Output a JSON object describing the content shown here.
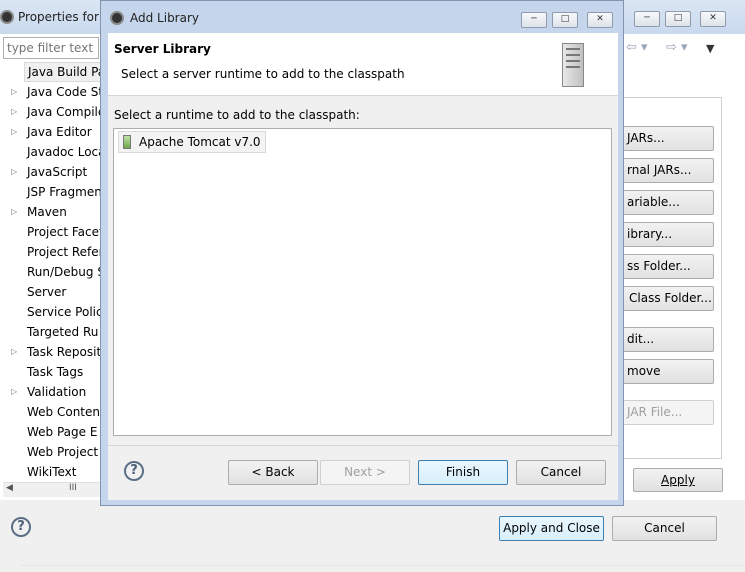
{
  "parent": {
    "title": "Properties for",
    "filter_placeholder": "type filter text",
    "tree": [
      {
        "label": "Java Build Pa",
        "arrow": false,
        "selected": true
      },
      {
        "label": "Java Code St",
        "arrow": true
      },
      {
        "label": "Java Compile",
        "arrow": true
      },
      {
        "label": "Java Editor",
        "arrow": true
      },
      {
        "label": "Javadoc Loca",
        "arrow": false
      },
      {
        "label": "JavaScript",
        "arrow": true
      },
      {
        "label": "JSP Fragmen",
        "arrow": false
      },
      {
        "label": "Maven",
        "arrow": true
      },
      {
        "label": "Project Facet",
        "arrow": false
      },
      {
        "label": "Project Refer",
        "arrow": false
      },
      {
        "label": "Run/Debug S",
        "arrow": false
      },
      {
        "label": "Server",
        "arrow": false
      },
      {
        "label": "Service Polic",
        "arrow": false
      },
      {
        "label": "Targeted Ru",
        "arrow": false
      },
      {
        "label": "Task Reposit",
        "arrow": true
      },
      {
        "label": "Task Tags",
        "arrow": false
      },
      {
        "label": "Validation",
        "arrow": true
      },
      {
        "label": "Web Conten",
        "arrow": false
      },
      {
        "label": "Web Page E",
        "arrow": false
      },
      {
        "label": "Web Project",
        "arrow": false
      },
      {
        "label": "WikiText",
        "arrow": false
      }
    ],
    "side_buttons": [
      {
        "label": "JARs...",
        "disabled": false
      },
      {
        "label": "rnal JARs...",
        "disabled": false
      },
      {
        "label": "ariable...",
        "disabled": false
      },
      {
        "label": "ibrary...",
        "disabled": false
      },
      {
        "label": "ss Folder...",
        "disabled": false
      },
      {
        "label": "Class Folder...",
        "disabled": false
      },
      {
        "label": "dit...",
        "disabled": false
      },
      {
        "label": "move",
        "disabled": false
      },
      {
        "label": "JAR File...",
        "disabled": true
      }
    ],
    "apply_label": "Apply",
    "apply_close_label": "Apply and Close",
    "cancel_label": "Cancel",
    "hscroll_grip": "III"
  },
  "dialog": {
    "title": "Add Library",
    "header_title": "Server Library",
    "header_desc": "Select a server runtime to add to the classpath",
    "list_label": "Select a runtime to add to the classpath:",
    "runtimes": [
      "Apache Tomcat v7.0"
    ],
    "back_label": "< Back",
    "next_label": "Next >",
    "finish_label": "Finish",
    "cancel_label": "Cancel"
  },
  "icons": {
    "window": "eclipse-gear-icon",
    "header": "server-icon",
    "runtime": "server-runtime-icon",
    "help": "help-icon"
  }
}
